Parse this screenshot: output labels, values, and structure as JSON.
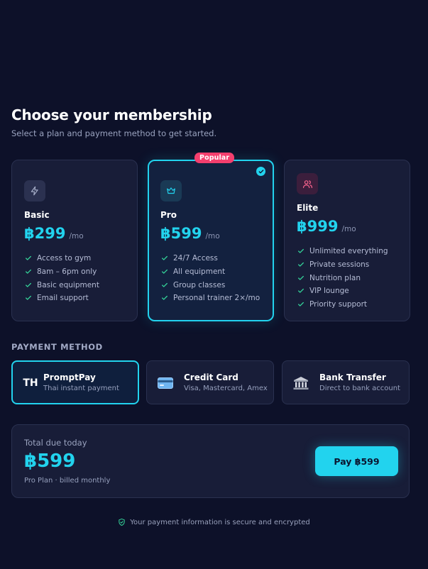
{
  "header": {
    "title": "Choose your membership",
    "subtitle": "Select a plan and payment method to get started."
  },
  "plans": [
    {
      "icon": "bolt-icon",
      "name": "Basic",
      "price": "฿299",
      "period": "/mo",
      "features": [
        "Access to gym",
        "8am – 6pm only",
        "Basic equipment",
        "Email support"
      ]
    },
    {
      "icon": "crown-icon",
      "name": "Pro",
      "price": "฿599",
      "period": "/mo",
      "badge": "Popular",
      "selected": true,
      "features": [
        "24/7 Access",
        "All equipment",
        "Group classes",
        "Personal trainer 2×/mo"
      ]
    },
    {
      "icon": "users-icon",
      "name": "Elite",
      "price": "฿999",
      "period": "/mo",
      "features": [
        "Unlimited everything",
        "Private sessions",
        "Nutrition plan",
        "VIP lounge",
        "Priority support"
      ]
    }
  ],
  "payment": {
    "section_label": "PAYMENT METHOD",
    "methods": [
      {
        "icon_text": "TH",
        "name": "PromptPay",
        "sub": "Thai instant payment",
        "selected": true
      },
      {
        "icon": "credit-card-icon",
        "name": "Credit Card",
        "sub": "Visa, Mastercard, Amex"
      },
      {
        "icon": "bank-icon",
        "name": "Bank Transfer",
        "sub": "Direct to bank account"
      }
    ]
  },
  "summary": {
    "label": "Total due today",
    "amount": "฿599",
    "plan_text": "Pro Plan · billed monthly",
    "pay_button": "Pay ฿599"
  },
  "footer": {
    "secure_text": "Your payment information is secure and encrypted"
  },
  "colors": {
    "background": "#0d1129",
    "accent": "#22d3ee",
    "badge": "#f43f6e",
    "check": "#34d399"
  }
}
